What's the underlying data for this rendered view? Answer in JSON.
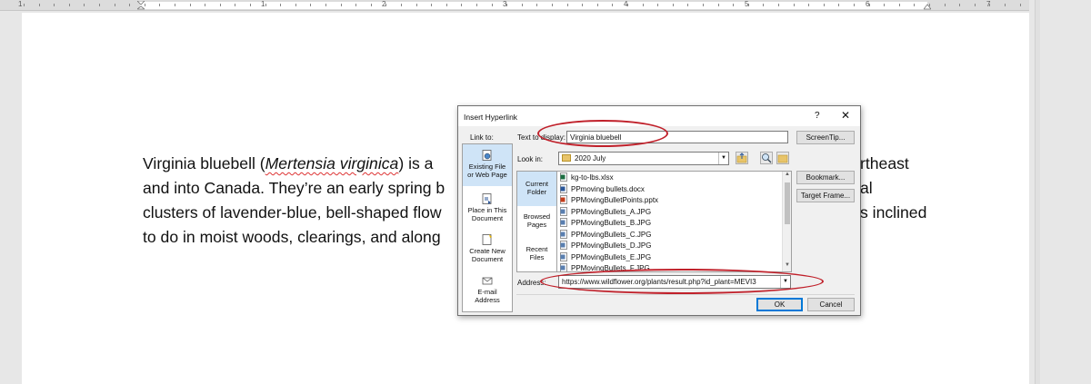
{
  "ruler": {
    "numbers": [
      "1",
      "1",
      "2",
      "3",
      "4",
      "5",
      "6",
      "7"
    ]
  },
  "document": {
    "lines": [
      {
        "pre": "Virginia bluebell (",
        "italic": "Mertensia virginica",
        "post": ") is a",
        "tail": "rtheast"
      },
      {
        "pre": "and into Canada. They’re an early spring b",
        "tail": "al"
      },
      {
        "pre": "clusters of lavender-blue, bell-shaped flow",
        "tail": "s inclined"
      },
      {
        "pre": "to do  in moist woods, clearings, and along"
      }
    ]
  },
  "dialog": {
    "title": "Insert Hyperlink",
    "help_label": "?",
    "close_label": "✕",
    "link_to_label": "Link to:",
    "text_to_display_label": "Text to display:",
    "text_to_display_value": "Virginia bluebell",
    "screentip_button": "ScreenTip...",
    "look_in_label": "Look in:",
    "look_in_value": "2020 July",
    "bookmark_button": "Bookmark...",
    "target_frame_button": "Target Frame...",
    "address_label": "Address:",
    "address_value": "https://www.wildflower.org/plants/result.php?id_plant=MEVI3",
    "ok_button": "OK",
    "cancel_button": "Cancel",
    "link_to_items": [
      {
        "label_a": "Existing File",
        "label_b": "or Web Page",
        "icon": "globe-file-icon",
        "selected": true
      },
      {
        "label_a": "Place in This",
        "label_b": "Document",
        "icon": "document-place-icon",
        "selected": false
      },
      {
        "label_a": "Create New",
        "label_b": "Document",
        "icon": "new-document-icon",
        "selected": false
      },
      {
        "label_a": "E-mail",
        "label_b": "Address",
        "icon": "email-icon",
        "selected": false
      }
    ],
    "browse_items": [
      {
        "label_a": "Current",
        "label_b": "Folder",
        "selected": true
      },
      {
        "label_a": "Browsed",
        "label_b": "Pages",
        "selected": false
      },
      {
        "label_a": "Recent",
        "label_b": "Files",
        "selected": false
      }
    ],
    "files": [
      {
        "name": "kg-to-lbs.xlsx",
        "icon": "excel-file-icon",
        "color": "#1d6f42"
      },
      {
        "name": "PPmoving bullets.docx",
        "icon": "word-file-icon",
        "color": "#2b579a"
      },
      {
        "name": "PPMovingBulletPoints.pptx",
        "icon": "powerpoint-file-icon",
        "color": "#c43e1c"
      },
      {
        "name": "PPMovingBullets_A.JPG",
        "icon": "image-file-icon",
        "color": "#5a7fb0"
      },
      {
        "name": "PPMovingBullets_B.JPG",
        "icon": "image-file-icon",
        "color": "#5a7fb0"
      },
      {
        "name": "PPMovingBullets_C.JPG",
        "icon": "image-file-icon",
        "color": "#5a7fb0"
      },
      {
        "name": "PPMovingBullets_D.JPG",
        "icon": "image-file-icon",
        "color": "#5a7fb0"
      },
      {
        "name": "PPMovingBullets_E.JPG",
        "icon": "image-file-icon",
        "color": "#5a7fb0"
      },
      {
        "name": "PPMovingBullets_F.JPG",
        "icon": "image-file-icon",
        "color": "#5a7fb0"
      }
    ]
  },
  "colors": {
    "annotation_red": "#c0202a",
    "selection_blue": "#cfe4f7",
    "ok_border": "#0078d7"
  }
}
